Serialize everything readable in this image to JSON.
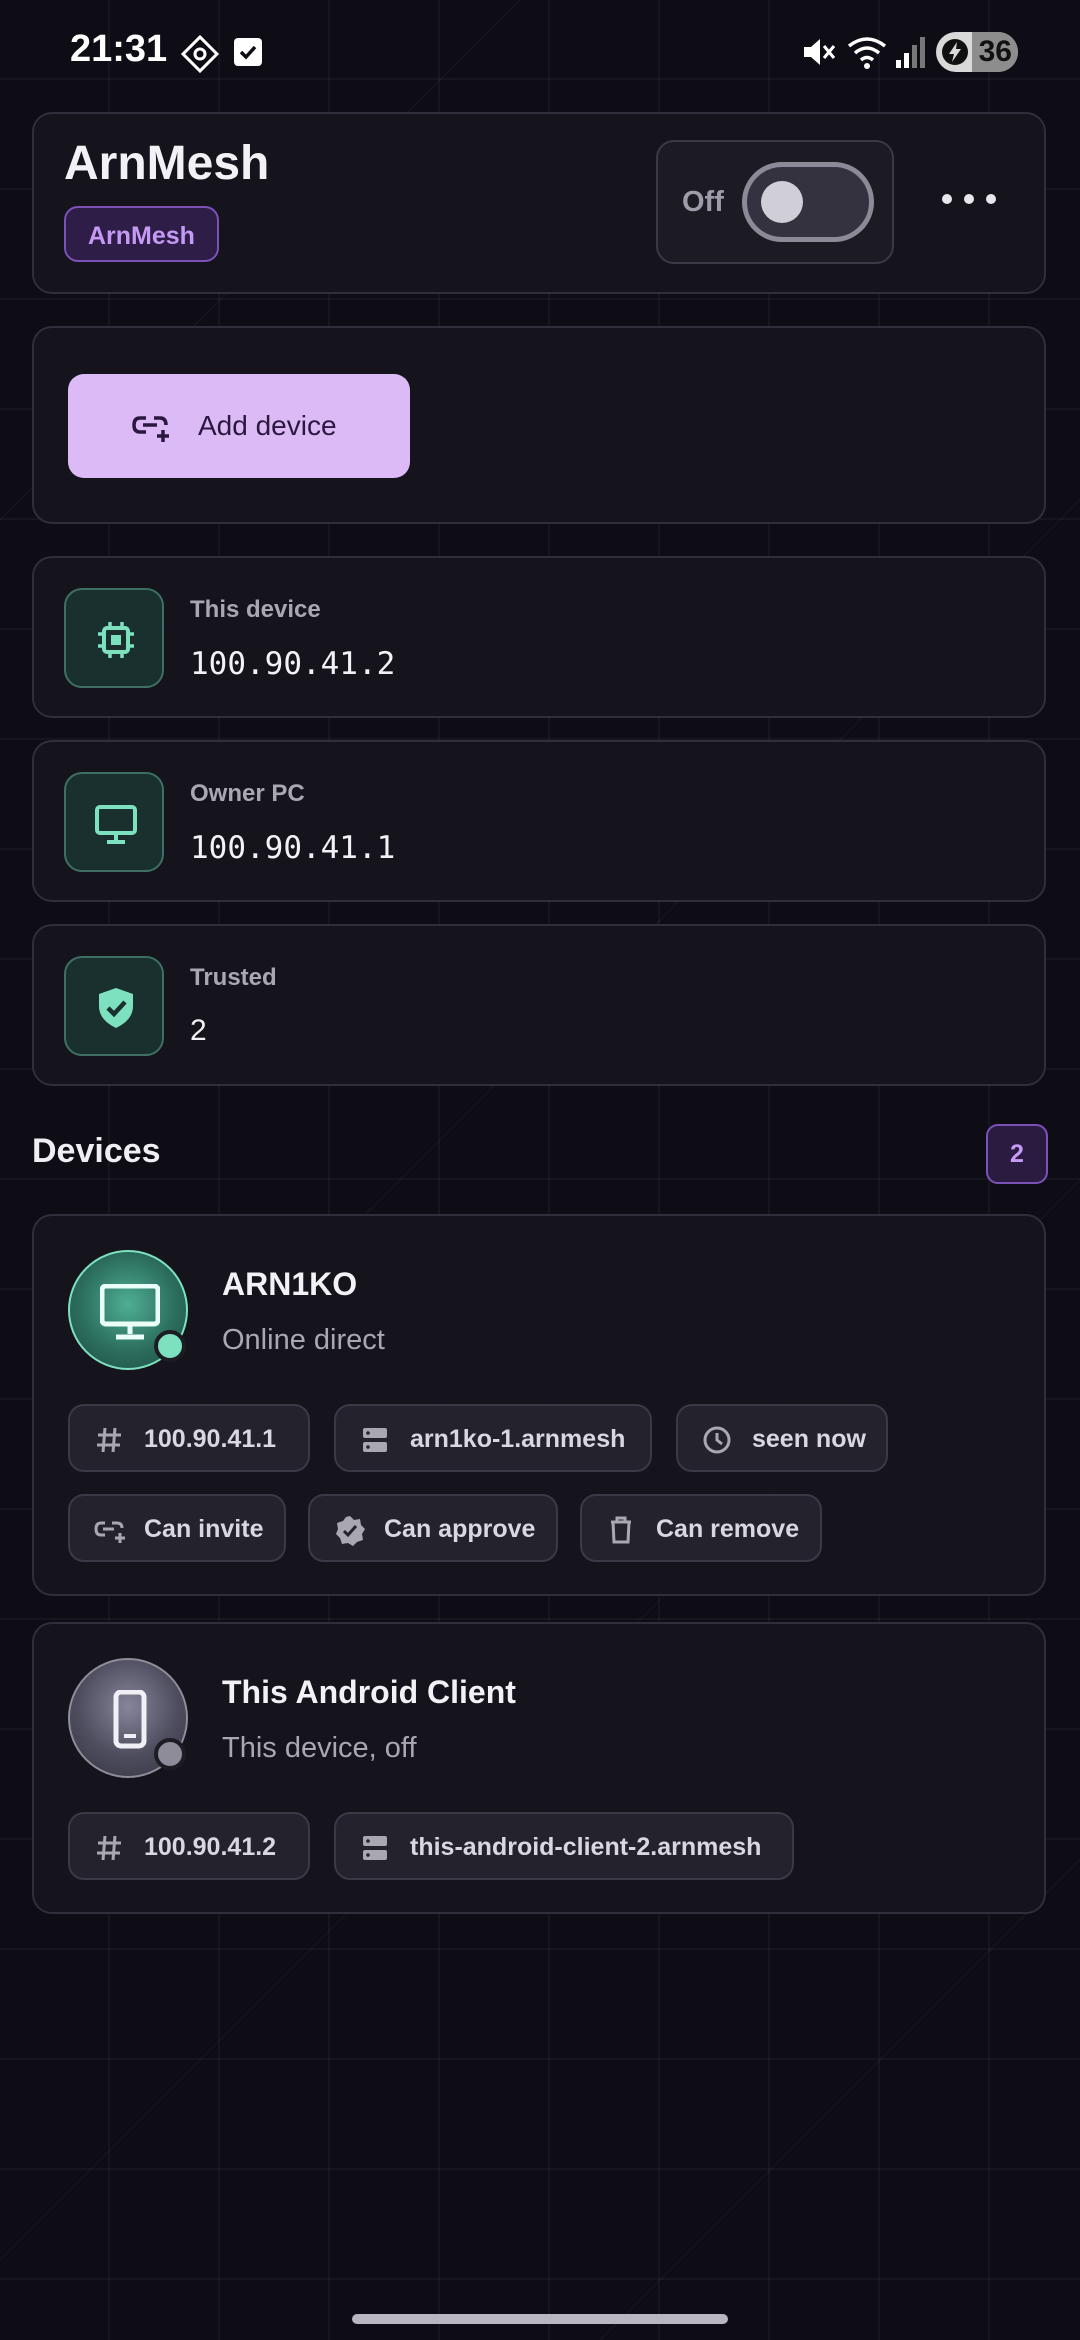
{
  "status_bar": {
    "time": "21:31",
    "battery_level": "36"
  },
  "header": {
    "app_title": "ArnMesh",
    "badge": "ArnMesh",
    "toggle_label": "Off",
    "toggle_on": false
  },
  "actions": {
    "add_device_label": "Add device"
  },
  "stats": [
    {
      "label": "This device",
      "value": "100.90.41.2",
      "icon": "chip-icon"
    },
    {
      "label": "Owner PC",
      "value": "100.90.41.1",
      "icon": "monitor-icon"
    },
    {
      "label": "Trusted",
      "value": "2",
      "icon": "shield-check-icon"
    }
  ],
  "devices_section": {
    "title": "Devices",
    "count": "2",
    "items": [
      {
        "name": "ARN1KO",
        "status": "Online direct",
        "presence_color": "#7de0bf",
        "chips": [
          {
            "icon": "hash-icon",
            "label": "100.90.41.1"
          },
          {
            "icon": "server-icon",
            "label": "arn1ko-1.arnmesh"
          },
          {
            "icon": "clock-icon",
            "label": "seen now"
          },
          {
            "icon": "link-plus-icon",
            "label": "Can invite"
          },
          {
            "icon": "verified-badge-icon",
            "label": "Can approve"
          },
          {
            "icon": "trash-icon",
            "label": "Can remove"
          }
        ]
      },
      {
        "name": "This Android Client",
        "status": "This device, off",
        "presence_color": "#8d8c98",
        "chips": [
          {
            "icon": "hash-icon",
            "label": "100.90.41.2"
          },
          {
            "icon": "server-icon",
            "label": "this-android-client-2.arnmesh"
          }
        ]
      }
    ]
  },
  "colors": {
    "accent": "#dcbaf5",
    "badge_purple": "#c59af5",
    "teal": "#7de0bf",
    "background": "#0e0d16"
  }
}
